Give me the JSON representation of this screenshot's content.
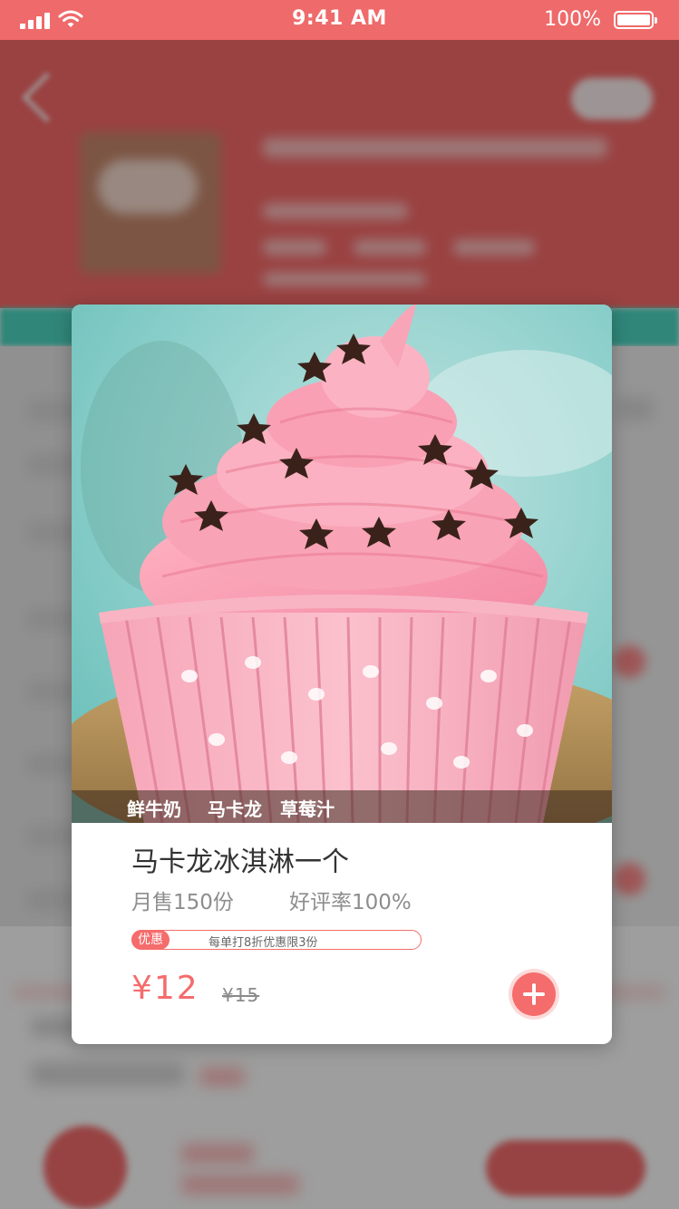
{
  "status_bar": {
    "time": "9:41 AM",
    "battery_text": "100%",
    "battery_level": 1.0
  },
  "product": {
    "tags": [
      "鲜牛奶",
      "马卡龙",
      "草莓汁"
    ],
    "name": "马卡龙冰淇淋一个",
    "monthly_sales": "月售150份",
    "rating": "好评率100%",
    "promo_badge": "优惠",
    "promo_text": "每单打8折优惠限3份",
    "price": "¥12",
    "original_price": "¥15",
    "image": "pink-cupcake-photo"
  },
  "icons": {
    "add": "plus-icon",
    "back": "back-arrow-icon"
  },
  "colors": {
    "accent": "#f56c6c",
    "header": "#f96b6b",
    "teal": "#4ed9c4"
  }
}
